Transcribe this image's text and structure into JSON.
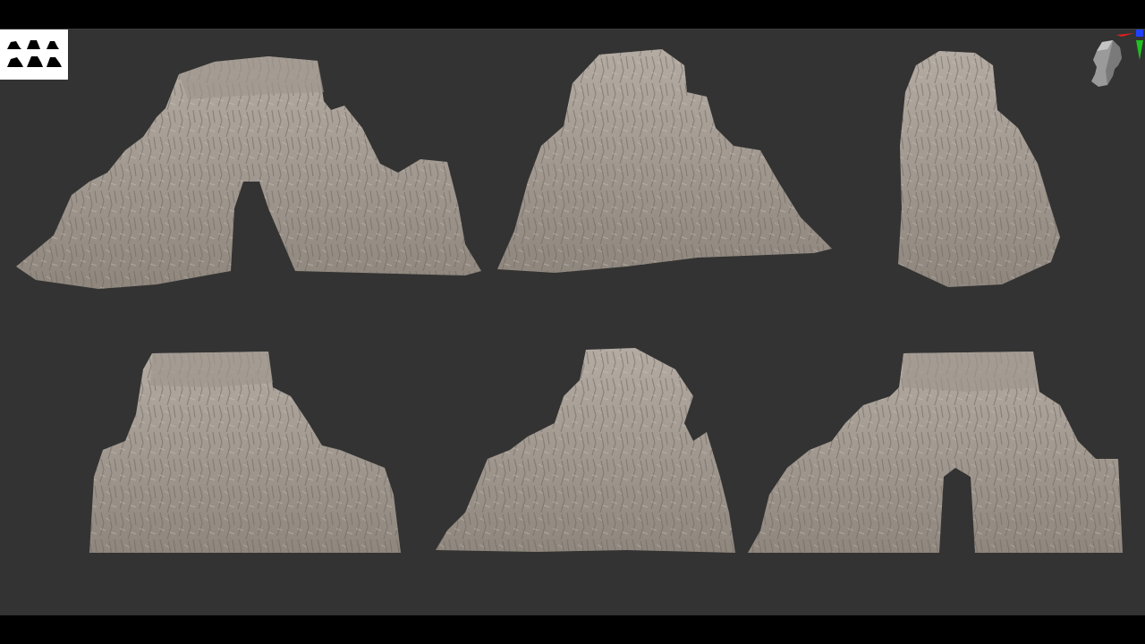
{
  "app": {
    "viewport": "3d-viewport",
    "background_color": "#333333"
  },
  "toolbar": {
    "thumbnail_icon": "subtool-thumbnail-icon"
  },
  "scene": {
    "object_color": "#a8a098",
    "models": [
      "rock-arch-left",
      "rock-spire-cluster",
      "rock-tower",
      "rock-block-front",
      "rock-peak-front",
      "rock-arch-front"
    ]
  },
  "gizmo": {
    "icon": "head-orientation-gizmo-icon",
    "axis_colors": {
      "x": "#e02020",
      "y": "#20c020",
      "z": "#2040ff"
    }
  }
}
